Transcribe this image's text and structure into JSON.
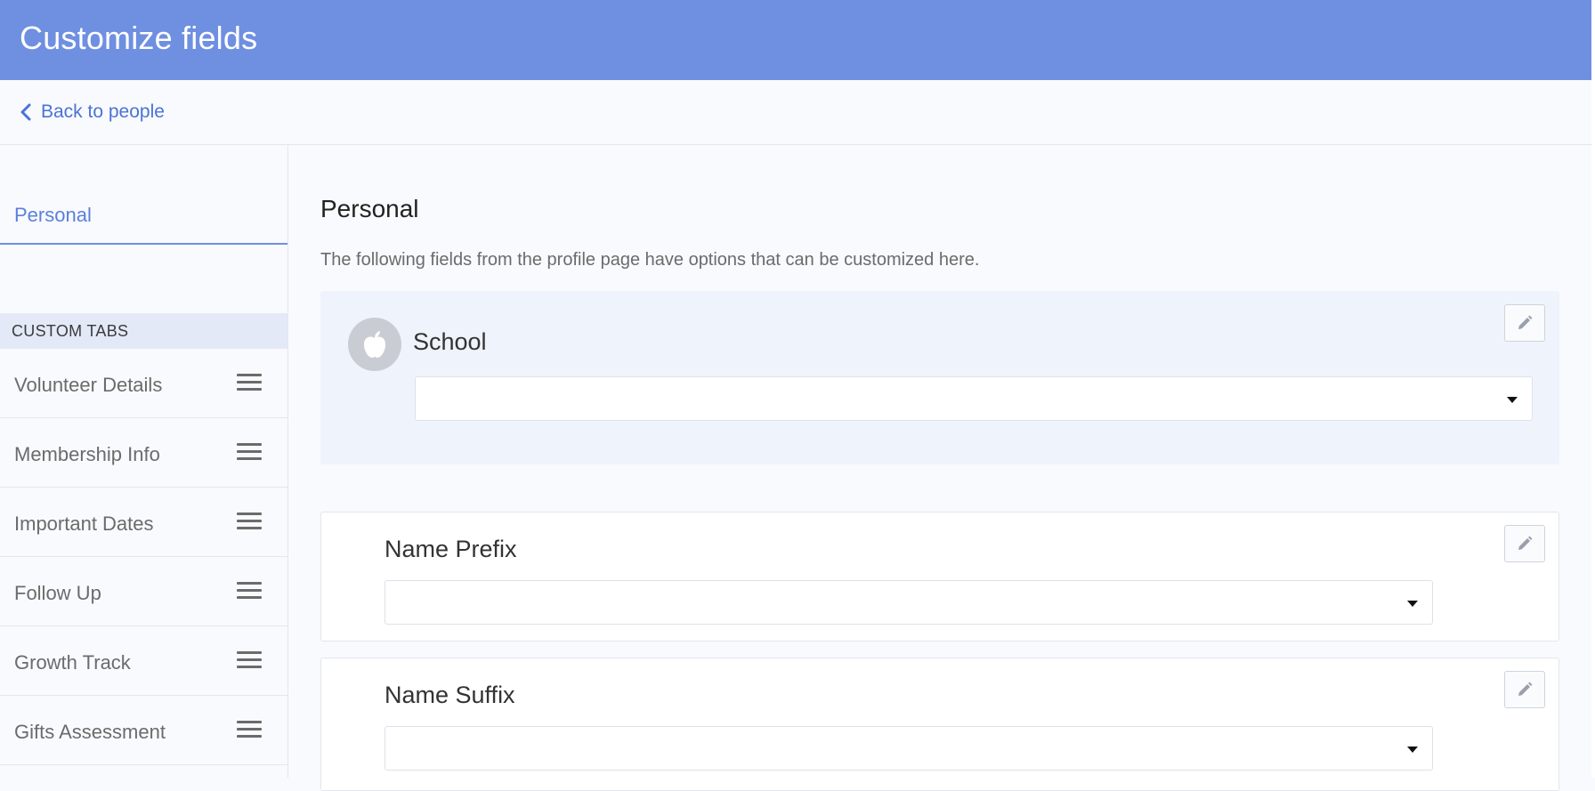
{
  "header": {
    "title": "Customize fields"
  },
  "nav": {
    "back_label": "Back to people"
  },
  "sidebar": {
    "personal_label": "Personal",
    "custom_tabs_heading": "CUSTOM TABS",
    "custom_tabs": [
      {
        "label": "Volunteer Details"
      },
      {
        "label": "Membership Info"
      },
      {
        "label": "Important Dates"
      },
      {
        "label": "Follow Up"
      },
      {
        "label": "Growth Track"
      },
      {
        "label": "Gifts Assessment"
      }
    ]
  },
  "main": {
    "title": "Personal",
    "description": "The following fields from the profile page have options that can be customized here.",
    "fields": [
      {
        "label": "School",
        "value": "",
        "icon": "apple-icon"
      },
      {
        "label": "Name Prefix",
        "value": ""
      },
      {
        "label": "Name Suffix",
        "value": ""
      }
    ]
  },
  "colors": {
    "header_bg": "#6f8fe1",
    "accent": "#4a73d6",
    "page_bg": "#f9fafe",
    "custom_tabs_bg": "#e3e9f7",
    "school_card_bg": "#eff3fb"
  }
}
